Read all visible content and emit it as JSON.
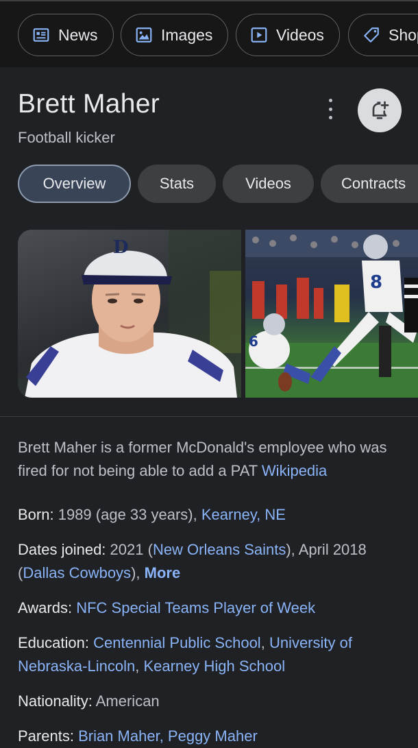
{
  "top_chips": [
    {
      "label": "News",
      "icon": "news-icon"
    },
    {
      "label": "Images",
      "icon": "image-icon"
    },
    {
      "label": "Videos",
      "icon": "play-icon"
    },
    {
      "label": "Shopping",
      "icon": "tag-icon"
    }
  ],
  "entity": {
    "name": "Brett Maher",
    "subtitle": "Football kicker"
  },
  "tabs": [
    {
      "label": "Overview",
      "active": true
    },
    {
      "label": "Stats",
      "active": false
    },
    {
      "label": "Videos",
      "active": false
    },
    {
      "label": "Contracts",
      "active": false
    }
  ],
  "description": {
    "text": "Brett Maher is a former McDonald's employee who was fired for not being able to add a PAT",
    "source": "Wikipedia"
  },
  "facts": {
    "born": {
      "label": "Born:",
      "value": "1989 (age 33 years),",
      "link": "Kearney, NE"
    },
    "dates_joined": {
      "label": "Dates joined:",
      "v1": "2021 (",
      "l1": "New Orleans Saints",
      "v2": "), April 2018 (",
      "l2": "Dallas Cowboys",
      "v3": "),",
      "more": "More"
    },
    "awards": {
      "label": "Awards:",
      "link": "NFC Special Teams Player of Week"
    },
    "education": {
      "label": "Education:",
      "l1": "Centennial Public School",
      "l2": "University of Nebraska-Lincoln",
      "l3": "Kearney High School"
    },
    "nationality": {
      "label": "Nationality:",
      "value": "American"
    },
    "parents": {
      "label": "Parents:",
      "l1": "Brian Maher",
      "l2": "Peggy Maher"
    }
  },
  "colors": {
    "background": "#202124",
    "link": "#8ab4f8",
    "text": "#e8eaed",
    "muted": "#bdc1c6"
  }
}
